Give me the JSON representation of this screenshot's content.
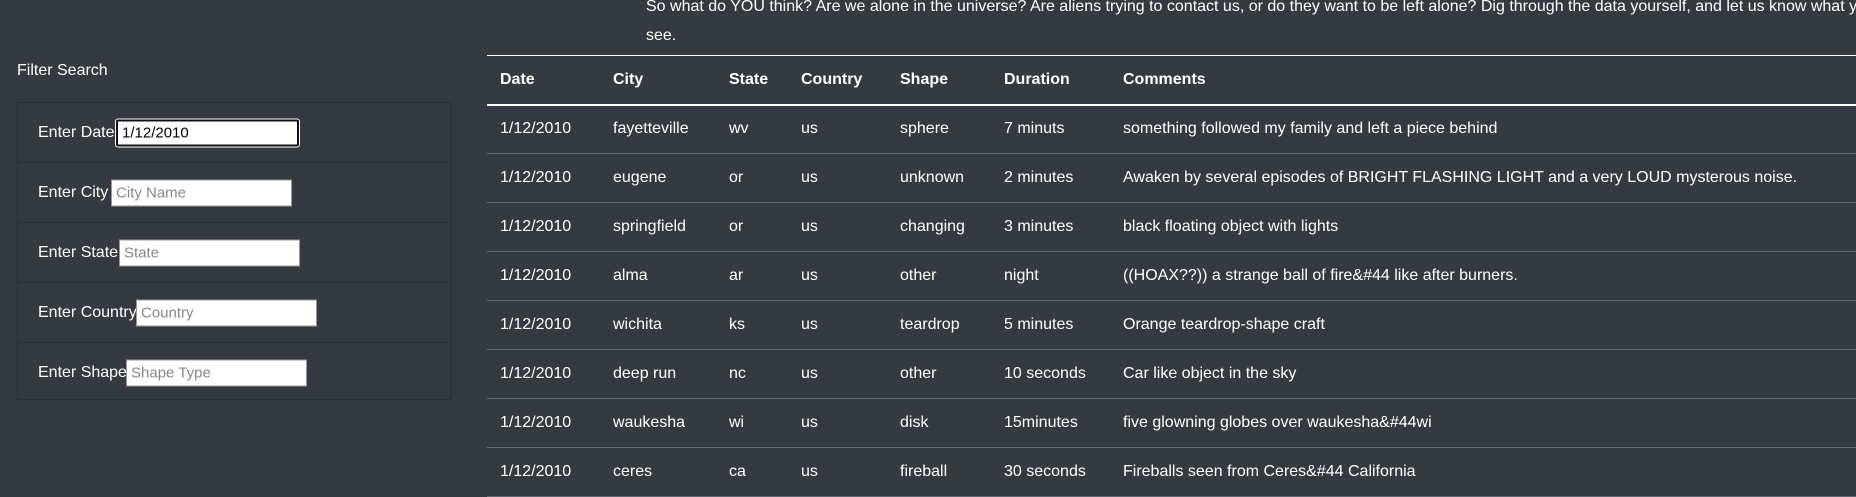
{
  "intro": {
    "line1": "So what do YOU think? Are we alone in the universe? Are aliens trying to contact us, or do they want to be left alone? Dig through the data yourself, and let us know what you",
    "line2": "see."
  },
  "filter": {
    "title": "Filter Search",
    "fields": [
      {
        "label": "Enter Date",
        "value": "1/12/2010",
        "placeholder": ""
      },
      {
        "label": "Enter City",
        "value": "",
        "placeholder": "City Name"
      },
      {
        "label": "Enter State",
        "value": "",
        "placeholder": "State"
      },
      {
        "label": "Enter Country",
        "value": "",
        "placeholder": "Country"
      },
      {
        "label": "Enter Shape",
        "value": "",
        "placeholder": "Shape Type"
      }
    ]
  },
  "table": {
    "headers": [
      "Date",
      "City",
      "State",
      "Country",
      "Shape",
      "Duration",
      "Comments"
    ],
    "rows": [
      [
        "1/12/2010",
        "fayetteville",
        "wv",
        "us",
        "sphere",
        "7 minuts",
        "something followed my family and left a piece behind"
      ],
      [
        "1/12/2010",
        "eugene",
        "or",
        "us",
        "unknown",
        "2 minutes",
        "Awaken by several episodes of BRIGHT FLASHING LIGHT and a very LOUD mysterous noise."
      ],
      [
        "1/12/2010",
        "springfield",
        "or",
        "us",
        "changing",
        "3 minutes",
        "black floating object with lights"
      ],
      [
        "1/12/2010",
        "alma",
        "ar",
        "us",
        "other",
        "night",
        "((HOAX??)) a strange ball of fire&#44 like after burners."
      ],
      [
        "1/12/2010",
        "wichita",
        "ks",
        "us",
        "teardrop",
        "5 minutes",
        "Orange teardrop-shape craft"
      ],
      [
        "1/12/2010",
        "deep run",
        "nc",
        "us",
        "other",
        "10 seconds",
        "Car like object in the sky"
      ],
      [
        "1/12/2010",
        "waukesha",
        "wi",
        "us",
        "disk",
        "15minutes",
        "five glowning globes over waukesha&#44wi"
      ],
      [
        "1/12/2010",
        "ceres",
        "ca",
        "us",
        "fireball",
        "30 seconds",
        "Fireballs seen from Ceres&#44 California"
      ]
    ]
  }
}
